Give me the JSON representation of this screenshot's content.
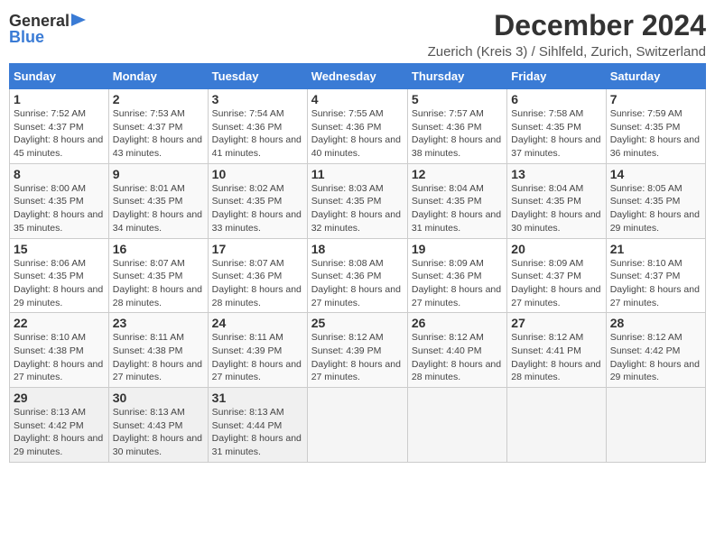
{
  "header": {
    "logo_general": "General",
    "logo_blue": "Blue",
    "title": "December 2024",
    "subtitle": "Zuerich (Kreis 3) / Sihlfeld, Zurich, Switzerland"
  },
  "days_of_week": [
    "Sunday",
    "Monday",
    "Tuesday",
    "Wednesday",
    "Thursday",
    "Friday",
    "Saturday"
  ],
  "weeks": [
    [
      {
        "day": "1",
        "sunrise": "Sunrise: 7:52 AM",
        "sunset": "Sunset: 4:37 PM",
        "daylight": "Daylight: 8 hours and 45 minutes."
      },
      {
        "day": "2",
        "sunrise": "Sunrise: 7:53 AM",
        "sunset": "Sunset: 4:37 PM",
        "daylight": "Daylight: 8 hours and 43 minutes."
      },
      {
        "day": "3",
        "sunrise": "Sunrise: 7:54 AM",
        "sunset": "Sunset: 4:36 PM",
        "daylight": "Daylight: 8 hours and 41 minutes."
      },
      {
        "day": "4",
        "sunrise": "Sunrise: 7:55 AM",
        "sunset": "Sunset: 4:36 PM",
        "daylight": "Daylight: 8 hours and 40 minutes."
      },
      {
        "day": "5",
        "sunrise": "Sunrise: 7:57 AM",
        "sunset": "Sunset: 4:36 PM",
        "daylight": "Daylight: 8 hours and 38 minutes."
      },
      {
        "day": "6",
        "sunrise": "Sunrise: 7:58 AM",
        "sunset": "Sunset: 4:35 PM",
        "daylight": "Daylight: 8 hours and 37 minutes."
      },
      {
        "day": "7",
        "sunrise": "Sunrise: 7:59 AM",
        "sunset": "Sunset: 4:35 PM",
        "daylight": "Daylight: 8 hours and 36 minutes."
      }
    ],
    [
      {
        "day": "8",
        "sunrise": "Sunrise: 8:00 AM",
        "sunset": "Sunset: 4:35 PM",
        "daylight": "Daylight: 8 hours and 35 minutes."
      },
      {
        "day": "9",
        "sunrise": "Sunrise: 8:01 AM",
        "sunset": "Sunset: 4:35 PM",
        "daylight": "Daylight: 8 hours and 34 minutes."
      },
      {
        "day": "10",
        "sunrise": "Sunrise: 8:02 AM",
        "sunset": "Sunset: 4:35 PM",
        "daylight": "Daylight: 8 hours and 33 minutes."
      },
      {
        "day": "11",
        "sunrise": "Sunrise: 8:03 AM",
        "sunset": "Sunset: 4:35 PM",
        "daylight": "Daylight: 8 hours and 32 minutes."
      },
      {
        "day": "12",
        "sunrise": "Sunrise: 8:04 AM",
        "sunset": "Sunset: 4:35 PM",
        "daylight": "Daylight: 8 hours and 31 minutes."
      },
      {
        "day": "13",
        "sunrise": "Sunrise: 8:04 AM",
        "sunset": "Sunset: 4:35 PM",
        "daylight": "Daylight: 8 hours and 30 minutes."
      },
      {
        "day": "14",
        "sunrise": "Sunrise: 8:05 AM",
        "sunset": "Sunset: 4:35 PM",
        "daylight": "Daylight: 8 hours and 29 minutes."
      }
    ],
    [
      {
        "day": "15",
        "sunrise": "Sunrise: 8:06 AM",
        "sunset": "Sunset: 4:35 PM",
        "daylight": "Daylight: 8 hours and 29 minutes."
      },
      {
        "day": "16",
        "sunrise": "Sunrise: 8:07 AM",
        "sunset": "Sunset: 4:35 PM",
        "daylight": "Daylight: 8 hours and 28 minutes."
      },
      {
        "day": "17",
        "sunrise": "Sunrise: 8:07 AM",
        "sunset": "Sunset: 4:36 PM",
        "daylight": "Daylight: 8 hours and 28 minutes."
      },
      {
        "day": "18",
        "sunrise": "Sunrise: 8:08 AM",
        "sunset": "Sunset: 4:36 PM",
        "daylight": "Daylight: 8 hours and 27 minutes."
      },
      {
        "day": "19",
        "sunrise": "Sunrise: 8:09 AM",
        "sunset": "Sunset: 4:36 PM",
        "daylight": "Daylight: 8 hours and 27 minutes."
      },
      {
        "day": "20",
        "sunrise": "Sunrise: 8:09 AM",
        "sunset": "Sunset: 4:37 PM",
        "daylight": "Daylight: 8 hours and 27 minutes."
      },
      {
        "day": "21",
        "sunrise": "Sunrise: 8:10 AM",
        "sunset": "Sunset: 4:37 PM",
        "daylight": "Daylight: 8 hours and 27 minutes."
      }
    ],
    [
      {
        "day": "22",
        "sunrise": "Sunrise: 8:10 AM",
        "sunset": "Sunset: 4:38 PM",
        "daylight": "Daylight: 8 hours and 27 minutes."
      },
      {
        "day": "23",
        "sunrise": "Sunrise: 8:11 AM",
        "sunset": "Sunset: 4:38 PM",
        "daylight": "Daylight: 8 hours and 27 minutes."
      },
      {
        "day": "24",
        "sunrise": "Sunrise: 8:11 AM",
        "sunset": "Sunset: 4:39 PM",
        "daylight": "Daylight: 8 hours and 27 minutes."
      },
      {
        "day": "25",
        "sunrise": "Sunrise: 8:12 AM",
        "sunset": "Sunset: 4:39 PM",
        "daylight": "Daylight: 8 hours and 27 minutes."
      },
      {
        "day": "26",
        "sunrise": "Sunrise: 8:12 AM",
        "sunset": "Sunset: 4:40 PM",
        "daylight": "Daylight: 8 hours and 28 minutes."
      },
      {
        "day": "27",
        "sunrise": "Sunrise: 8:12 AM",
        "sunset": "Sunset: 4:41 PM",
        "daylight": "Daylight: 8 hours and 28 minutes."
      },
      {
        "day": "28",
        "sunrise": "Sunrise: 8:12 AM",
        "sunset": "Sunset: 4:42 PM",
        "daylight": "Daylight: 8 hours and 29 minutes."
      }
    ],
    [
      {
        "day": "29",
        "sunrise": "Sunrise: 8:13 AM",
        "sunset": "Sunset: 4:42 PM",
        "daylight": "Daylight: 8 hours and 29 minutes."
      },
      {
        "day": "30",
        "sunrise": "Sunrise: 8:13 AM",
        "sunset": "Sunset: 4:43 PM",
        "daylight": "Daylight: 8 hours and 30 minutes."
      },
      {
        "day": "31",
        "sunrise": "Sunrise: 8:13 AM",
        "sunset": "Sunset: 4:44 PM",
        "daylight": "Daylight: 8 hours and 31 minutes."
      },
      null,
      null,
      null,
      null
    ]
  ]
}
